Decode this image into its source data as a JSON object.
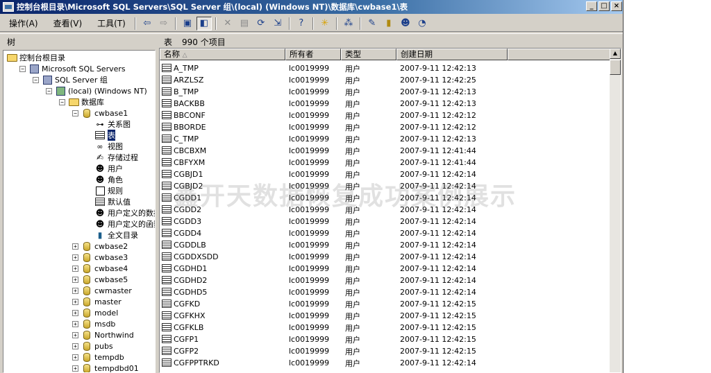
{
  "window": {
    "title": "控制台根目录\\Microsoft SQL Servers\\SQL Server 组\\(local) (Windows NT)\\数据库\\cwbase1\\表"
  },
  "menu": {
    "items": [
      "操作(A)",
      "查看(V)",
      "工具(T)"
    ]
  },
  "panes": {
    "tree_tab": "树",
    "list_tab": "表",
    "item_count": "990 个项目"
  },
  "tree": [
    {
      "label": "控制台根目录",
      "icon": "folder-icon",
      "indent": 0,
      "expander": ""
    },
    {
      "label": "Microsoft SQL Servers",
      "icon": "server-group-icon",
      "indent": 1,
      "expander": "-"
    },
    {
      "label": "SQL Server 组",
      "icon": "server-group-icon",
      "indent": 2,
      "expander": "-"
    },
    {
      "label": "(local) (Windows NT)",
      "icon": "server-icon",
      "indent": 3,
      "expander": "-"
    },
    {
      "label": "数据库",
      "icon": "folder-icon",
      "indent": 4,
      "expander": "-"
    },
    {
      "label": "cwbase1",
      "icon": "database-icon",
      "indent": 5,
      "expander": "-"
    },
    {
      "label": "关系图",
      "icon": "diagram-icon",
      "indent": 6,
      "expander": ""
    },
    {
      "label": "表",
      "icon": "table-icon",
      "indent": 6,
      "expander": "",
      "selected": true
    },
    {
      "label": "视图",
      "icon": "view-icon",
      "indent": 6,
      "expander": ""
    },
    {
      "label": "存储过程",
      "icon": "stored-procedure-icon",
      "indent": 6,
      "expander": ""
    },
    {
      "label": "用户",
      "icon": "user-icon",
      "indent": 6,
      "expander": ""
    },
    {
      "label": "角色",
      "icon": "role-icon",
      "indent": 6,
      "expander": ""
    },
    {
      "label": "规则",
      "icon": "rule-icon",
      "indent": 6,
      "expander": ""
    },
    {
      "label": "默认值",
      "icon": "default-icon",
      "indent": 6,
      "expander": ""
    },
    {
      "label": "用户定义的数据",
      "icon": "user-type-icon",
      "indent": 6,
      "expander": ""
    },
    {
      "label": "用户定义的函数",
      "icon": "user-function-icon",
      "indent": 6,
      "expander": ""
    },
    {
      "label": "全文目录",
      "icon": "fulltext-catalog-icon",
      "indent": 6,
      "expander": ""
    },
    {
      "label": "cwbase2",
      "icon": "database-icon",
      "indent": 5,
      "expander": "+"
    },
    {
      "label": "cwbase3",
      "icon": "database-icon",
      "indent": 5,
      "expander": "+"
    },
    {
      "label": "cwbase4",
      "icon": "database-icon",
      "indent": 5,
      "expander": "+"
    },
    {
      "label": "cwbase5",
      "icon": "database-icon",
      "indent": 5,
      "expander": "+"
    },
    {
      "label": "cwmaster",
      "icon": "database-icon",
      "indent": 5,
      "expander": "+"
    },
    {
      "label": "master",
      "icon": "database-icon",
      "indent": 5,
      "expander": "+"
    },
    {
      "label": "model",
      "icon": "database-icon",
      "indent": 5,
      "expander": "+"
    },
    {
      "label": "msdb",
      "icon": "database-icon",
      "indent": 5,
      "expander": "+"
    },
    {
      "label": "Northwind",
      "icon": "database-icon",
      "indent": 5,
      "expander": "+"
    },
    {
      "label": "pubs",
      "icon": "database-icon",
      "indent": 5,
      "expander": "+"
    },
    {
      "label": "tempdb",
      "icon": "database-icon",
      "indent": 5,
      "expander": "+"
    },
    {
      "label": "tempdbd01",
      "icon": "database-icon",
      "indent": 5,
      "expander": "+"
    }
  ],
  "list": {
    "columns": [
      "名称",
      "所有者",
      "类型",
      "创建日期"
    ],
    "rows": [
      [
        "A_TMP",
        "lc0019999",
        "用户",
        "2007-9-11 12:42:13"
      ],
      [
        "ARZLSZ",
        "lc0019999",
        "用户",
        "2007-9-11 12:42:25"
      ],
      [
        "B_TMP",
        "lc0019999",
        "用户",
        "2007-9-11 12:42:13"
      ],
      [
        "BACKBB",
        "lc0019999",
        "用户",
        "2007-9-11 12:42:13"
      ],
      [
        "BBCONF",
        "lc0019999",
        "用户",
        "2007-9-11 12:42:12"
      ],
      [
        "BBORDE",
        "lc0019999",
        "用户",
        "2007-9-11 12:42:12"
      ],
      [
        "C_TMP",
        "lc0019999",
        "用户",
        "2007-9-11 12:42:13"
      ],
      [
        "CBCBXM",
        "lc0019999",
        "用户",
        "2007-9-11 12:41:44"
      ],
      [
        "CBFYXM",
        "lc0019999",
        "用户",
        "2007-9-11 12:41:44"
      ],
      [
        "CGBJD1",
        "lc0019999",
        "用户",
        "2007-9-11 12:42:14"
      ],
      [
        "CGBJD2",
        "lc0019999",
        "用户",
        "2007-9-11 12:42:14"
      ],
      [
        "CGDD1",
        "lc0019999",
        "用户",
        "2007-9-11 12:42:14"
      ],
      [
        "CGDD2",
        "lc0019999",
        "用户",
        "2007-9-11 12:42:14"
      ],
      [
        "CGDD3",
        "lc0019999",
        "用户",
        "2007-9-11 12:42:14"
      ],
      [
        "CGDD4",
        "lc0019999",
        "用户",
        "2007-9-11 12:42:14"
      ],
      [
        "CGDDLB",
        "lc0019999",
        "用户",
        "2007-9-11 12:42:14"
      ],
      [
        "CGDDXSDD",
        "lc0019999",
        "用户",
        "2007-9-11 12:42:14"
      ],
      [
        "CGDHD1",
        "lc0019999",
        "用户",
        "2007-9-11 12:42:14"
      ],
      [
        "CGDHD2",
        "lc0019999",
        "用户",
        "2007-9-11 12:42:14"
      ],
      [
        "CGDHD5",
        "lc0019999",
        "用户",
        "2007-9-11 12:42:14"
      ],
      [
        "CGFKD",
        "lc0019999",
        "用户",
        "2007-9-11 12:42:15"
      ],
      [
        "CGFKHX",
        "lc0019999",
        "用户",
        "2007-9-11 12:42:15"
      ],
      [
        "CGFKLB",
        "lc0019999",
        "用户",
        "2007-9-11 12:42:15"
      ],
      [
        "CGFP1",
        "lc0019999",
        "用户",
        "2007-9-11 12:42:15"
      ],
      [
        "CGFP2",
        "lc0019999",
        "用户",
        "2007-9-11 12:42:15"
      ],
      [
        "CGFPPTRKD",
        "lc0019999",
        "用户",
        "2007-9-11 12:42:14"
      ]
    ]
  },
  "watermark": "鑫开天数据恢复成功案例展示"
}
